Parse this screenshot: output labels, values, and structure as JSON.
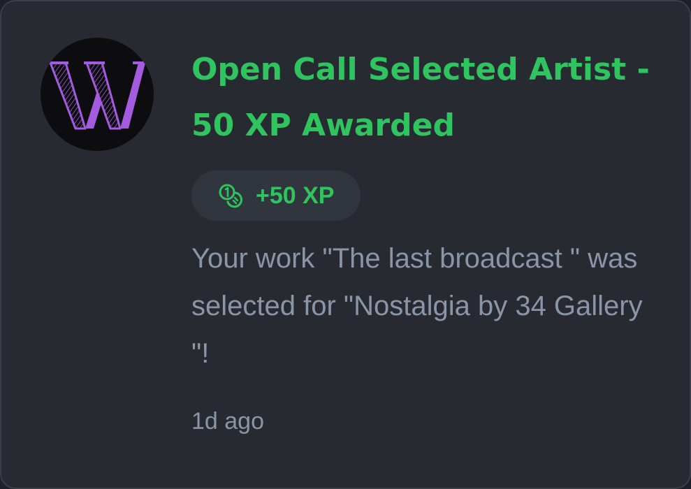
{
  "notification": {
    "avatar_icon": "w-logo-icon",
    "title": "Open Call Selected Artist - 50 XP Awarded",
    "xp_badge": {
      "icon": "coins-icon",
      "label": "+50 XP"
    },
    "message": "Your work \"The last broadcast \" was selected for \"Nostalgia by 34 Gallery \"!",
    "timestamp": "1d ago"
  },
  "colors": {
    "card_background": "#272a31",
    "title_green": "#2fc45f",
    "body_text": "#8a96a8",
    "logo_purple": "#a35be0"
  }
}
